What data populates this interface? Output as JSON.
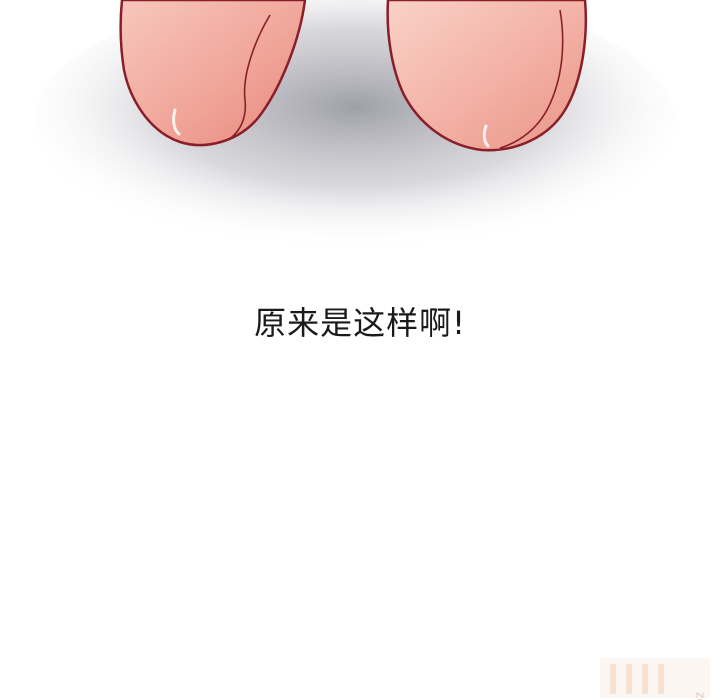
{
  "panel": {
    "caption": "原来是这样啊!",
    "watermark": "m.bz"
  },
  "colors": {
    "background": "#ffffff",
    "skin": "#f2a8a0",
    "outline": "#8a1f2a",
    "shadow": "#a9a9b0",
    "text": "#1a1a1a"
  }
}
